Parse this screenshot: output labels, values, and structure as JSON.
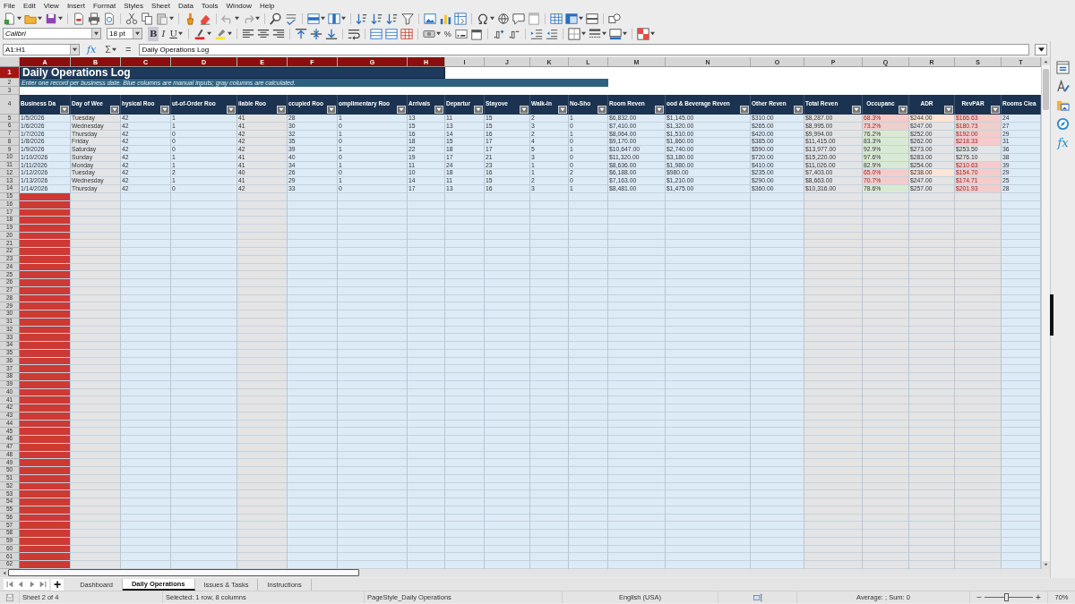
{
  "menu": [
    "File",
    "Edit",
    "View",
    "Insert",
    "Format",
    "Styles",
    "Sheet",
    "Data",
    "Tools",
    "Window",
    "Help"
  ],
  "format_toolbar": {
    "font_name": "Calibri",
    "font_size": "18 pt",
    "bold": {
      "label": "B",
      "on": true
    },
    "italic": {
      "label": "I",
      "on": false
    },
    "underline": {
      "label": "U",
      "on": false
    },
    "percent": "%"
  },
  "formula_bar": {
    "name_box": "A1:H1",
    "function_wizard": "fx",
    "sum": "Σ",
    "equals": "=",
    "formula": "Daily Operations Log"
  },
  "sheet": {
    "title": "Daily Operations Log",
    "subtitle": "Enter one record per business date. Blue columns are manual inputs; gray columns are calculated.",
    "columns": [
      {
        "letter": "A",
        "header": "Business Da",
        "kind": "input",
        "selected": true,
        "color": "#cc3a33"
      },
      {
        "letter": "B",
        "header": "Day of Wee",
        "kind": "calc",
        "selected": true
      },
      {
        "letter": "C",
        "header": "hysical Roo",
        "kind": "input",
        "selected": true
      },
      {
        "letter": "D",
        "header": "ut-of-Order Roo",
        "kind": "input",
        "selected": true
      },
      {
        "letter": "E",
        "header": "ilable Roo",
        "kind": "calc",
        "selected": true
      },
      {
        "letter": "F",
        "header": "ccupied Roo",
        "kind": "input",
        "selected": true
      },
      {
        "letter": "G",
        "header": "omplimentary Roo",
        "kind": "input",
        "selected": true
      },
      {
        "letter": "H",
        "header": "Arrivals",
        "kind": "input",
        "selected": true
      },
      {
        "letter": "I",
        "header": "Departur",
        "kind": "input",
        "selected": false
      },
      {
        "letter": "J",
        "header": "Stayove",
        "kind": "input",
        "selected": false
      },
      {
        "letter": "K",
        "header": "Walk-In",
        "kind": "input",
        "selected": false
      },
      {
        "letter": "L",
        "header": "No-Sho",
        "kind": "input",
        "selected": false
      },
      {
        "letter": "M",
        "header": "Room Reven",
        "kind": "input",
        "selected": false
      },
      {
        "letter": "N",
        "header": "ood & Beverage Reven",
        "kind": "input",
        "selected": false
      },
      {
        "letter": "O",
        "header": "Other Reven",
        "kind": "input",
        "selected": false
      },
      {
        "letter": "P",
        "header": "Total Reven",
        "kind": "calc",
        "selected": false
      },
      {
        "letter": "Q",
        "header": "Occupanc",
        "kind": "metric",
        "selected": false
      },
      {
        "letter": "R",
        "header": "ADR",
        "kind": "metric",
        "selected": false
      },
      {
        "letter": "S",
        "header": "RevPAR",
        "kind": "metric",
        "selected": false
      },
      {
        "letter": "T",
        "header": "Rooms Clea",
        "kind": "input",
        "selected": false
      }
    ],
    "row_numbers": [
      {
        "label": "1",
        "selected": true
      },
      {
        "label": "2",
        "selected": false
      },
      {
        "label": "3",
        "selected": false
      },
      {
        "label": "4",
        "selected": false
      },
      {
        "label": "5",
        "selected": false
      },
      {
        "label": "6",
        "selected": false
      },
      {
        "label": "7",
        "selected": false
      },
      {
        "label": "8",
        "selected": false
      },
      {
        "label": "9",
        "selected": false
      },
      {
        "label": "10",
        "selected": false
      },
      {
        "label": "11",
        "selected": false
      },
      {
        "label": "12",
        "selected": false
      },
      {
        "label": "13",
        "selected": false
      },
      {
        "label": "14",
        "selected": false
      },
      {
        "label": "15",
        "selected": false
      },
      {
        "label": "16",
        "selected": false
      },
      {
        "label": "17",
        "selected": false
      },
      {
        "label": "18",
        "selected": false
      },
      {
        "label": "19",
        "selected": false
      },
      {
        "label": "20",
        "selected": false
      },
      {
        "label": "21",
        "selected": false
      },
      {
        "label": "22",
        "selected": false
      },
      {
        "label": "23",
        "selected": false
      },
      {
        "label": "24",
        "selected": false
      },
      {
        "label": "25",
        "selected": false
      },
      {
        "label": "26",
        "selected": false
      },
      {
        "label": "27",
        "selected": false
      },
      {
        "label": "28",
        "selected": false
      },
      {
        "label": "29",
        "selected": false
      },
      {
        "label": "30",
        "selected": false
      },
      {
        "label": "31",
        "selected": false
      },
      {
        "label": "32",
        "selected": false
      },
      {
        "label": "33",
        "selected": false
      },
      {
        "label": "34",
        "selected": false
      },
      {
        "label": "35",
        "selected": false
      },
      {
        "label": "36",
        "selected": false
      },
      {
        "label": "37",
        "selected": false
      },
      {
        "label": "38",
        "selected": false
      },
      {
        "label": "39",
        "selected": false
      },
      {
        "label": "40",
        "selected": false
      },
      {
        "label": "41",
        "selected": false
      },
      {
        "label": "42",
        "selected": false
      },
      {
        "label": "43",
        "selected": false
      },
      {
        "label": "44",
        "selected": false
      },
      {
        "label": "45",
        "selected": false
      },
      {
        "label": "46",
        "selected": false
      },
      {
        "label": "47",
        "selected": false
      },
      {
        "label": "48",
        "selected": false
      },
      {
        "label": "49",
        "selected": false
      },
      {
        "label": "50",
        "selected": false
      },
      {
        "label": "51",
        "selected": false
      },
      {
        "label": "52",
        "selected": false
      },
      {
        "label": "53",
        "selected": false
      },
      {
        "label": "54",
        "selected": false
      },
      {
        "label": "55",
        "selected": false
      },
      {
        "label": "56",
        "selected": false
      },
      {
        "label": "57",
        "selected": false
      },
      {
        "label": "58",
        "selected": false
      },
      {
        "label": "59",
        "selected": false
      },
      {
        "label": "60",
        "selected": false
      },
      {
        "label": "61",
        "selected": false
      },
      {
        "label": "62",
        "selected": false
      }
    ],
    "data_rows": [
      {
        "cells": [
          "1/5/2026",
          "Tuesday",
          "42",
          "1",
          "41",
          "28",
          "1",
          "13",
          "11",
          "15",
          "2",
          "1",
          "$6,832.00",
          "$1,145.00",
          "$310.00",
          "$8,287.00",
          {
            "text": "68.3%",
            "color": "#f4cccc"
          },
          {
            "text": "$244.00",
            "color": "#fce4d6"
          },
          {
            "text": "$166.63",
            "color": "#f4cccc"
          },
          "24"
        ]
      },
      {
        "cells": [
          "1/6/2026",
          "Wednesday",
          "42",
          "1",
          "41",
          "30",
          "0",
          "15",
          "13",
          "15",
          "3",
          "0",
          "$7,410.00",
          "$1,320.00",
          "$265.00",
          "$8,995.00",
          {
            "text": "73.2%",
            "color": "#f4cccc"
          },
          {
            "text": "$247.00",
            "color": "#e4e4e4"
          },
          {
            "text": "$180.73",
            "color": "#f4cccc"
          },
          "27"
        ]
      },
      {
        "cells": [
          "1/7/2026",
          "Thursday",
          "42",
          "0",
          "42",
          "32",
          "1",
          "16",
          "14",
          "16",
          "2",
          "1",
          "$8,064.00",
          "$1,510.00",
          "$420.00",
          "$9,994.00",
          {
            "text": "76.2%",
            "color": "#d9ead3"
          },
          {
            "text": "$252.00",
            "color": "#e4e4e4"
          },
          {
            "text": "$192.00",
            "color": "#f4cccc"
          },
          "29"
        ]
      },
      {
        "cells": [
          "1/8/2026",
          "Friday",
          "42",
          "0",
          "42",
          "35",
          "0",
          "18",
          "15",
          "17",
          "4",
          "0",
          "$9,170.00",
          "$1,860.00",
          "$385.00",
          "$11,415.00",
          {
            "text": "83.3%",
            "color": "#d9ead3"
          },
          {
            "text": "$262.00",
            "color": "#e4e4e4"
          },
          {
            "text": "$218.33",
            "color": "#f4cccc"
          },
          "31"
        ]
      },
      {
        "cells": [
          "1/9/2026",
          "Saturday",
          "42",
          "0",
          "42",
          "39",
          "1",
          "22",
          "18",
          "17",
          "5",
          "1",
          "$10,647.00",
          "$2,740.00",
          "$590.00",
          "$13,977.00",
          {
            "text": "92.9%",
            "color": "#d9ead3"
          },
          {
            "text": "$273.00",
            "color": "#e4e4e4"
          },
          {
            "text": "$253.50",
            "color": "#e4e4e4"
          },
          "36"
        ]
      },
      {
        "cells": [
          "1/10/2026",
          "Sunday",
          "42",
          "1",
          "41",
          "40",
          "0",
          "19",
          "17",
          "21",
          "3",
          "0",
          "$11,320.00",
          "$3,180.00",
          "$720.00",
          "$15,220.00",
          {
            "text": "97.6%",
            "color": "#d9ead3"
          },
          {
            "text": "$283.00",
            "color": "#e4e4e4"
          },
          {
            "text": "$276.10",
            "color": "#e4e4e4"
          },
          "38"
        ]
      },
      {
        "cells": [
          "1/11/2026",
          "Monday",
          "42",
          "1",
          "41",
          "34",
          "1",
          "11",
          "24",
          "23",
          "1",
          "0",
          "$8,636.00",
          "$1,980.00",
          "$410.00",
          "$11,026.00",
          {
            "text": "82.9%",
            "color": "#d9ead3"
          },
          {
            "text": "$254.00",
            "color": "#e4e4e4"
          },
          {
            "text": "$210.63",
            "color": "#f4cccc"
          },
          "39"
        ]
      },
      {
        "cells": [
          "1/12/2026",
          "Tuesday",
          "42",
          "2",
          "40",
          "26",
          "0",
          "10",
          "18",
          "16",
          "1",
          "2",
          "$6,188.00",
          "$980.00",
          "$235.00",
          "$7,403.00",
          {
            "text": "65.0%",
            "color": "#f4cccc"
          },
          {
            "text": "$238.00",
            "color": "#fce4d6"
          },
          {
            "text": "$154.70",
            "color": "#f4cccc"
          },
          "29"
        ]
      },
      {
        "cells": [
          "1/13/2026",
          "Wednesday",
          "42",
          "1",
          "41",
          "29",
          "1",
          "14",
          "11",
          "15",
          "2",
          "0",
          "$7,163.00",
          "$1,210.00",
          "$290.00",
          "$8,663.00",
          {
            "text": "70.7%",
            "color": "#f4cccc"
          },
          {
            "text": "$247.00",
            "color": "#e4e4e4"
          },
          {
            "text": "$174.71",
            "color": "#f4cccc"
          },
          "25"
        ]
      },
      {
        "cells": [
          "1/14/2026",
          "Thursday",
          "42",
          "0",
          "42",
          "33",
          "0",
          "17",
          "13",
          "16",
          "3",
          "1",
          "$8,481.00",
          "$1,475.00",
          "$360.00",
          "$10,316.00",
          {
            "text": "78.6%",
            "color": "#d9ead3"
          },
          {
            "text": "$257.00",
            "color": "#e4e4e4"
          },
          {
            "text": "$201.93",
            "color": "#f4cccc"
          },
          "28"
        ]
      }
    ]
  },
  "sidebar": {
    "functions_label": "fx"
  },
  "sheet_tabs": {
    "add_label": "+",
    "tabs": [
      {
        "label": "Dashboard",
        "selected": false
      },
      {
        "label": "Daily Operations",
        "selected": true
      },
      {
        "label": "Issues & Tasks",
        "selected": false
      },
      {
        "label": "Instructions",
        "selected": false
      }
    ]
  },
  "status_bar": {
    "sheet": "Sheet 2 of 4",
    "selection": "Selected: 1 row, 8 columns",
    "page_style": "PageStyle_Daily Operations",
    "language": "English (USA)",
    "summary": "Average: ; Sum: 0",
    "zoom_out": "−",
    "zoom_in": "+",
    "zoom_slider": {
      "level": 0.45
    },
    "zoom": "70%"
  }
}
